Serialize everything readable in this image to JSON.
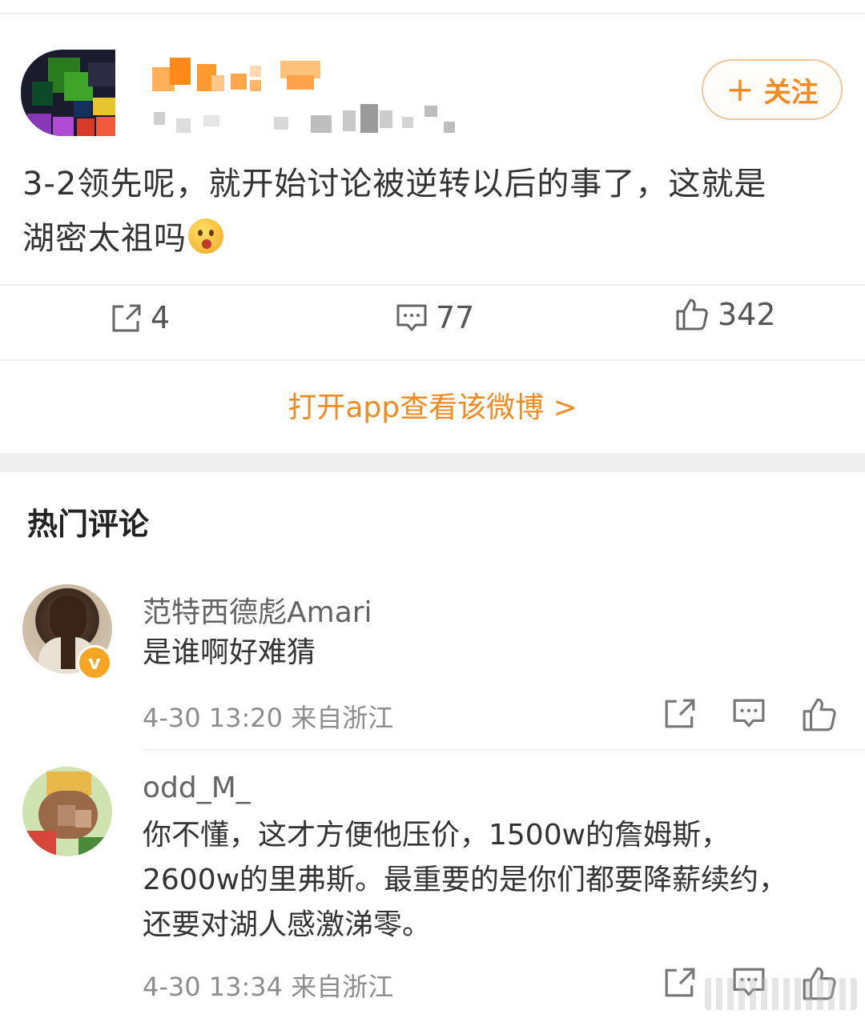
{
  "post": {
    "follow_label": "关注",
    "text_line1": "3-2领先呢，就开始讨论被逆转以后的事了，这就是",
    "text_line2": "湖密太祖吗",
    "repost_count": "4",
    "comment_count": "77",
    "like_count": "342",
    "open_app_label": "打开app查看该微博 >"
  },
  "hot_comments": {
    "title": "热门评论",
    "items": [
      {
        "name": "范特西德彪Amari",
        "text": "是谁啊好难猜",
        "meta": "4-30 13:20 来自浙江",
        "verified_label": "v"
      },
      {
        "name": "odd_M_",
        "text_line1": "你不懂，这才方便他压价，1500w的詹姆斯，",
        "text_line2": "2600w的里弗斯。最重要的是你们都要降薪续约，",
        "text_line3": "还要对湖人感激涕零。",
        "meta": "4-30 13:34 来自浙江"
      }
    ]
  },
  "colors": {
    "accent": "#f38a1f",
    "text": "#333333",
    "meta": "#8c8c8c"
  }
}
